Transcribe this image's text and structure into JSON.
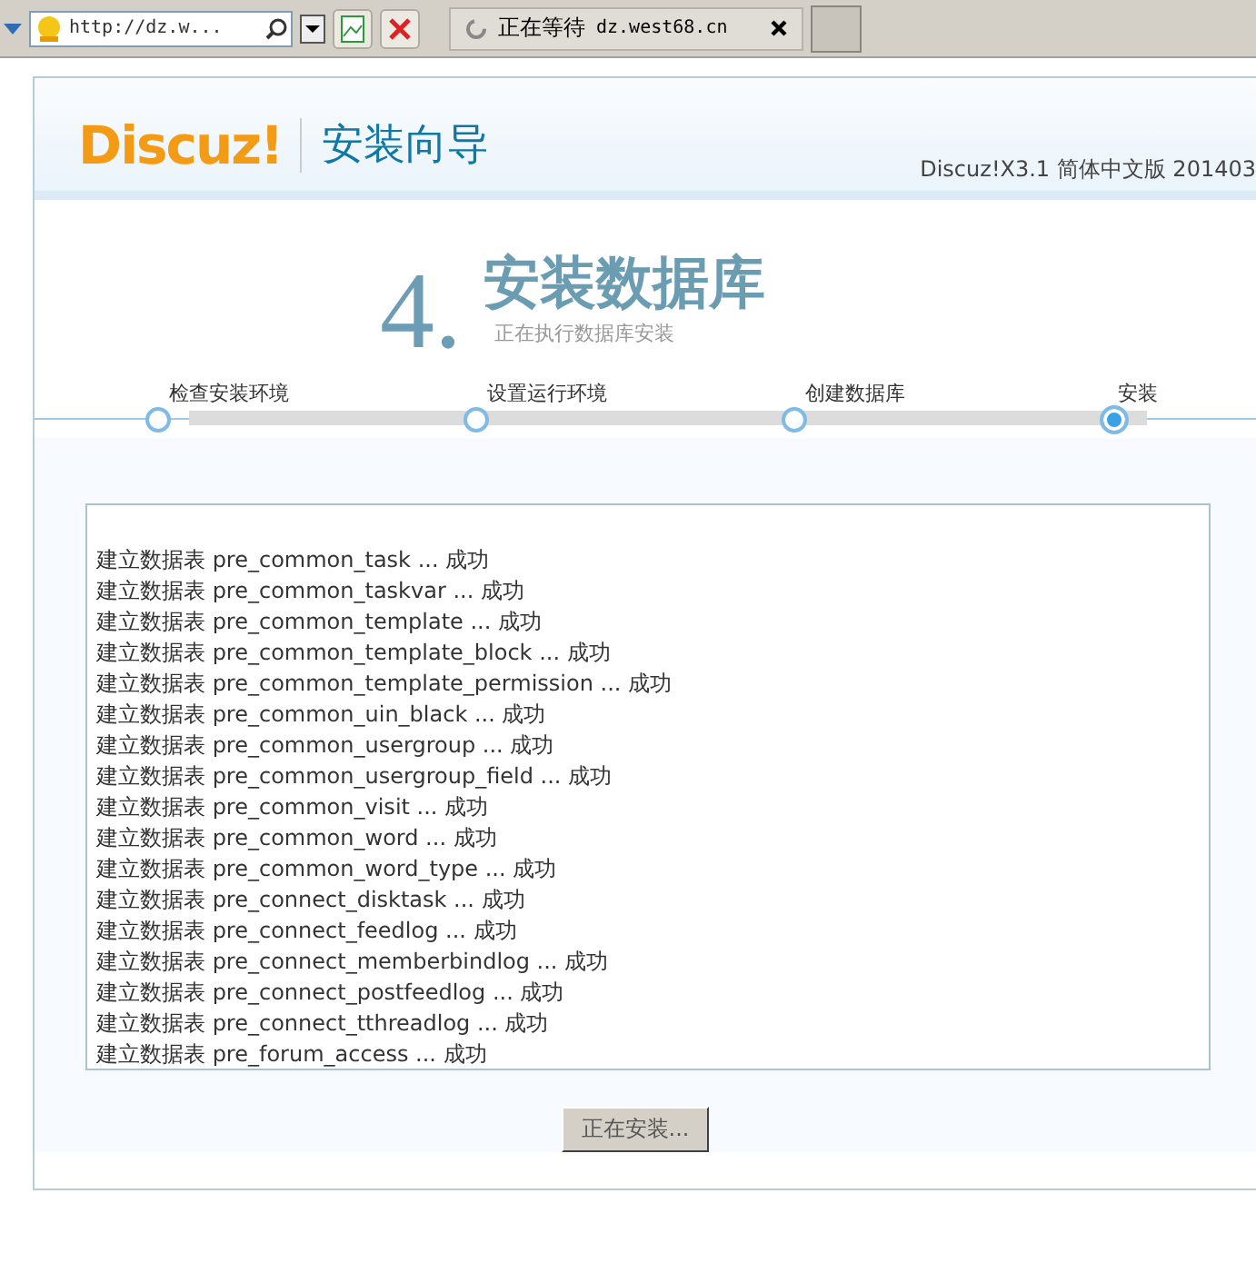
{
  "browser": {
    "address": "http://dz.w...",
    "tab": {
      "title": "正在等待",
      "url": "dz.west68.cn",
      "loading": true
    }
  },
  "header": {
    "logo": "Discuz!",
    "title": "安装向导",
    "version": "Discuz!X3.1 简体中文版 201403"
  },
  "step": {
    "number": "4.",
    "title": "安装数据库",
    "subtitle": "正在执行数据库安装"
  },
  "steps": [
    {
      "label": "检查安装环境",
      "selected": false
    },
    {
      "label": "设置运行环境",
      "selected": false
    },
    {
      "label": "创建数据库",
      "selected": false
    },
    {
      "label": "安装",
      "selected": true
    }
  ],
  "log": [
    "建立数据表 pre_common_task ... 成功",
    "建立数据表 pre_common_taskvar ... 成功",
    "建立数据表 pre_common_template ... 成功",
    "建立数据表 pre_common_template_block ... 成功",
    "建立数据表 pre_common_template_permission ... 成功",
    "建立数据表 pre_common_uin_black ... 成功",
    "建立数据表 pre_common_usergroup ... 成功",
    "建立数据表 pre_common_usergroup_field ... 成功",
    "建立数据表 pre_common_visit ... 成功",
    "建立数据表 pre_common_word ... 成功",
    "建立数据表 pre_common_word_type ... 成功",
    "建立数据表 pre_connect_disktask ... 成功",
    "建立数据表 pre_connect_feedlog ... 成功",
    "建立数据表 pre_connect_memberbindlog ... 成功",
    "建立数据表 pre_connect_postfeedlog ... 成功",
    "建立数据表 pre_connect_tthreadlog ... 成功",
    "建立数据表 pre_forum_access ... 成功"
  ],
  "button": {
    "label": "正在安装...",
    "disabled": true
  }
}
